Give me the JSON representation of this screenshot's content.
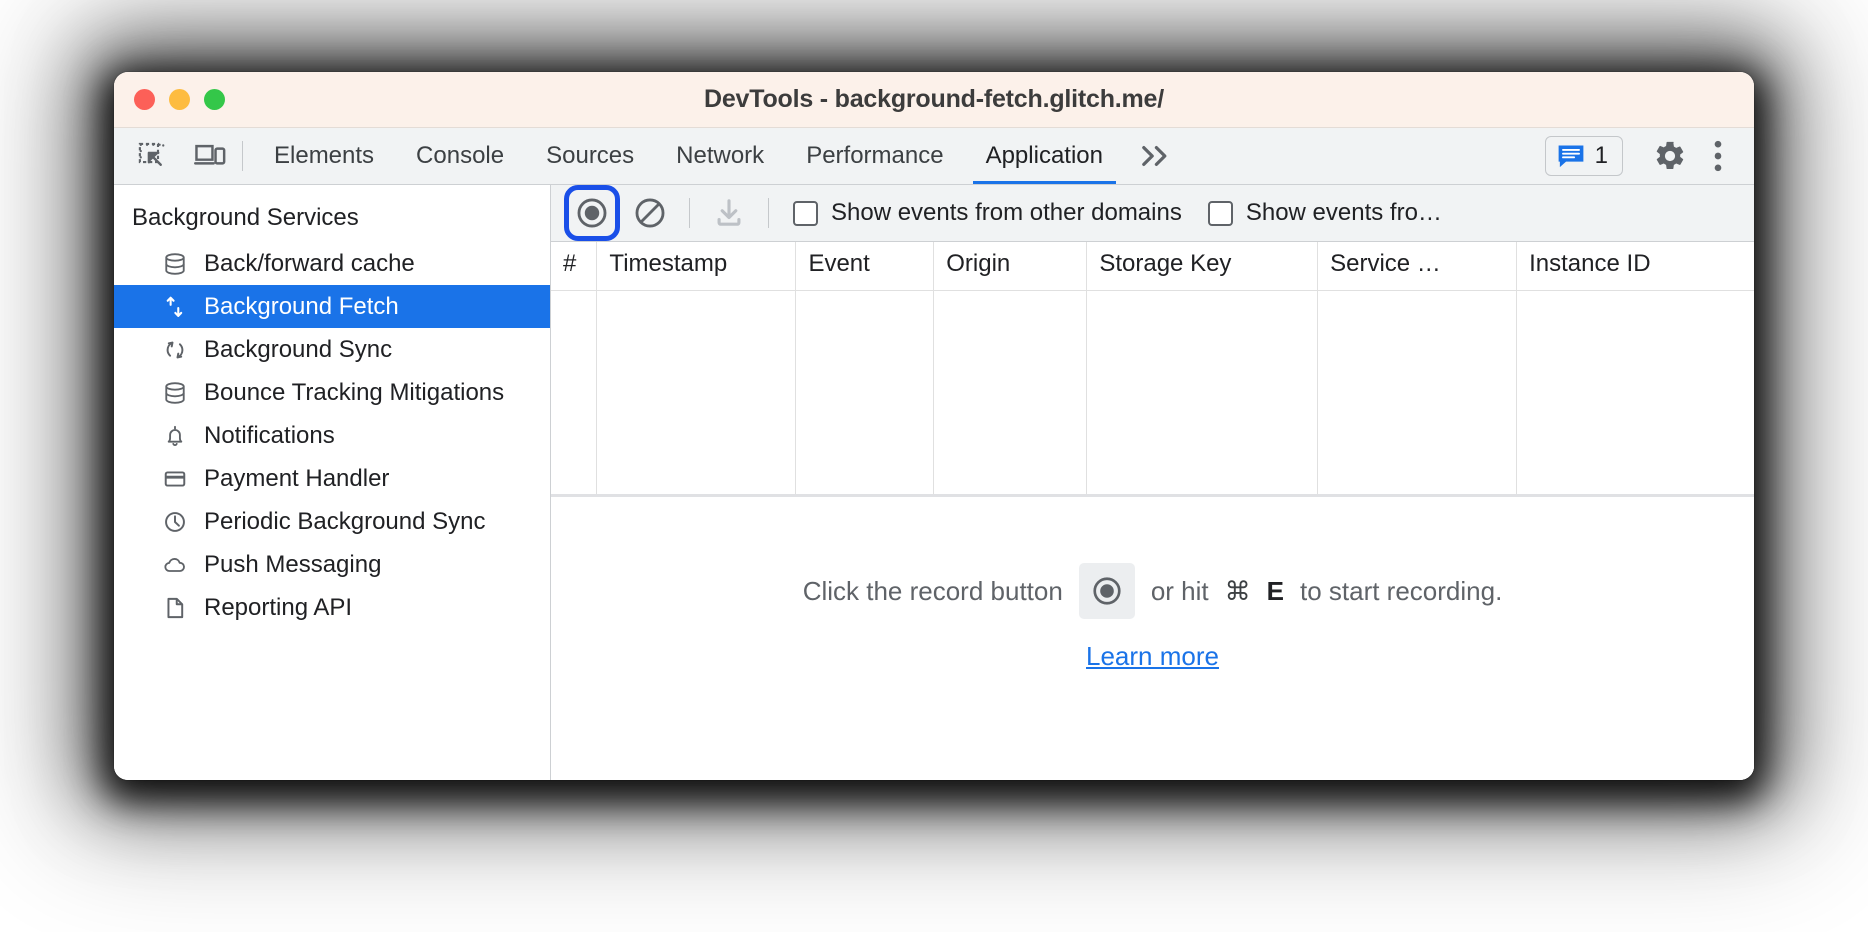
{
  "window": {
    "title": "DevTools - background-fetch.glitch.me/",
    "traffic_lights": [
      "close",
      "minimize",
      "maximize"
    ],
    "titlebar_bg": "#fcf1ea"
  },
  "tabstrip": {
    "left_icons": [
      {
        "name": "inspect-element-icon",
        "label": "Inspect element"
      },
      {
        "name": "device-toolbar-icon",
        "label": "Toggle device toolbar"
      }
    ],
    "tabs": [
      {
        "label": "Elements",
        "active": false
      },
      {
        "label": "Console",
        "active": false
      },
      {
        "label": "Sources",
        "active": false
      },
      {
        "label": "Network",
        "active": false
      },
      {
        "label": "Performance",
        "active": false
      },
      {
        "label": "Application",
        "active": true
      }
    ],
    "more_tabs_label": "»",
    "messages": {
      "icon": "message-icon",
      "count": "1",
      "accent": "#1a73e8"
    },
    "settings_label": "Settings",
    "kebab_label": "Customize and control DevTools"
  },
  "sidebar": {
    "header": "Background Services",
    "items": [
      {
        "label": "Back/forward cache",
        "icon": "database-icon",
        "selected": false
      },
      {
        "label": "Background Fetch",
        "icon": "up-down-arrows-icon",
        "selected": true
      },
      {
        "label": "Background Sync",
        "icon": "sync-icon",
        "selected": false
      },
      {
        "label": "Bounce Tracking Mitigations",
        "icon": "database-icon",
        "selected": false
      },
      {
        "label": "Notifications",
        "icon": "bell-icon",
        "selected": false
      },
      {
        "label": "Payment Handler",
        "icon": "credit-card-icon",
        "selected": false
      },
      {
        "label": "Periodic Background Sync",
        "icon": "clock-icon",
        "selected": false
      },
      {
        "label": "Push Messaging",
        "icon": "cloud-icon",
        "selected": false
      },
      {
        "label": "Reporting API",
        "icon": "document-icon",
        "selected": false
      }
    ],
    "selected_bg": "#1a73e8"
  },
  "toolbar": {
    "record_button": {
      "name": "record-button",
      "label": "Start recording events",
      "focused": true,
      "focus_ring_color": "#1a4fe8"
    },
    "clear_button": {
      "name": "clear-button",
      "label": "Clear"
    },
    "download_button": {
      "name": "save-events-button",
      "label": "Save events",
      "disabled": true
    },
    "checkboxes": [
      {
        "label": "Show events from other domains",
        "checked": false
      },
      {
        "label": "Show events fro…",
        "checked": false
      }
    ]
  },
  "table": {
    "columns": [
      "#",
      "Timestamp",
      "Event",
      "Origin",
      "Storage Key",
      "Service …",
      "Instance ID"
    ],
    "rows": []
  },
  "empty_state": {
    "prefix": "Click the record button",
    "record_icon": "record-icon",
    "middle": "or hit",
    "modifier": "⌘",
    "key": "E",
    "suffix": "to start recording.",
    "learn_more": "Learn more",
    "link_color": "#1a73e8"
  }
}
